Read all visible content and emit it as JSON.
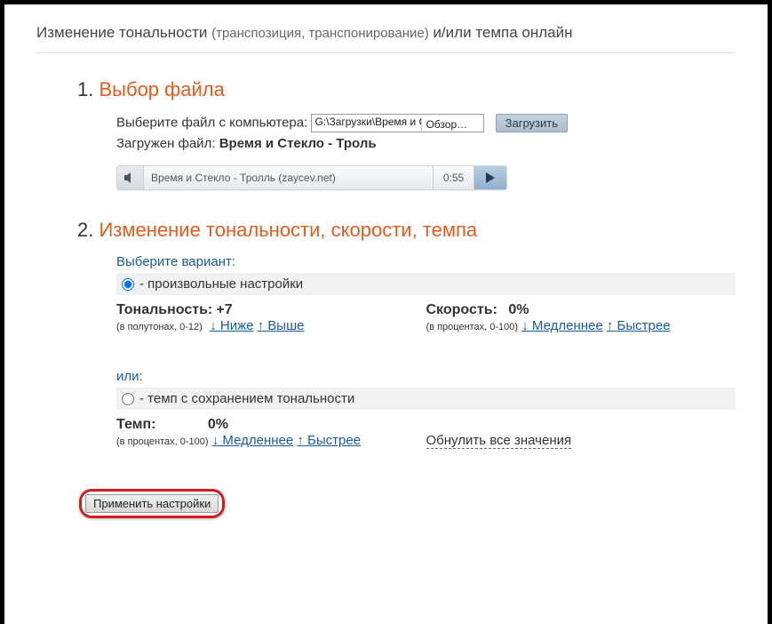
{
  "header": {
    "title_main": "Изменение тональности",
    "title_sub": "(транспозиция, транспонирование)",
    "title_tail": "и/или темпа онлайн"
  },
  "step1": {
    "num": "1.",
    "heading": "Выбор файла",
    "choose_label": "Выберите файл с компьютера:",
    "file_path": "G:\\Загрузки\\Время и С",
    "browse_label": "Обзор…",
    "upload_label": "Загрузить",
    "uploaded_label": "Загружен файл:",
    "uploaded_name": "Время и Стекло - Троль",
    "player_track": "Время и Стекло - Тролль (zaycev.net)",
    "player_time": "0:55"
  },
  "step2": {
    "num": "2.",
    "heading": "Изменение тональности, скорости, темпа",
    "choose_variant": "Выберите вариант:",
    "option_custom": "- произвольные настройки",
    "option_tempo_keep": "- темп с сохранением тональности",
    "tone_label": "Тональность:",
    "tone_value": "+7",
    "tone_note": "(в полутонах, 0-12)",
    "tone_down": "↓ Ниже",
    "tone_up": "↑ Выше",
    "speed_label": "Скорость:",
    "speed_value": "0%",
    "speed_note": "(в процентах, 0-100)",
    "speed_down": "↓ Медленнее",
    "speed_up": "↑ Быстрее",
    "or_label": "или:",
    "tempo_label": "Темп:",
    "tempo_value": "0%",
    "tempo_note": "(в процентах, 0-100)",
    "tempo_down": "↓ Медленнее",
    "tempo_up": "↑ Быстрее",
    "reset_label": "Обнулить все значения"
  },
  "apply": {
    "label": "Применить настройки"
  }
}
